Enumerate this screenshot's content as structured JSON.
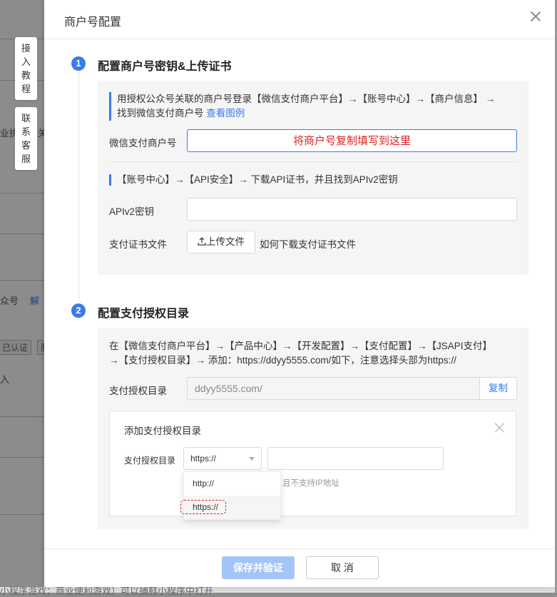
{
  "background": {
    "side_floats": [
      {
        "label": [
          "接",
          "入",
          "教",
          "程"
        ]
      },
      {
        "label": [
          "联",
          "系",
          "客",
          "服"
        ]
      }
    ],
    "fragments": {
      "text_1": "业执照",
      "text_2": "关",
      "text_3": "众号",
      "link_1": "解",
      "tag_1": "已认证",
      "tag_2": "服",
      "text_4": "入",
      "bottom": "小程序游戏；商业便利游戏）可以捕鞋小程序中打开"
    }
  },
  "modal": {
    "title": "商户号配置",
    "step1": {
      "number": "1",
      "title": "配置商户号密钥&上传证书",
      "hint1_text": "用授权公众号关联的商户号登录【微信支付商户平台】→【账号中心】→【商户信息】 →",
      "hint1_text2": "找到微信支付商户号",
      "hint1_link": "查看图例",
      "merchant_label": "微信支付商户号",
      "merchant_placeholder": "将商户号复制填写到这里",
      "hint2_text": "【账号中心】→【API安全】→ 下载API证书，并且找到APIv2密钥",
      "apikey_label": "APIv2密钥",
      "apikey_value": "",
      "cert_label": "支付证书文件",
      "upload_button": "上传文件",
      "cert_link": "如何下载支付证书文件"
    },
    "step2": {
      "number": "2",
      "title": "配置支付授权目录",
      "hint_line1": "在【微信支付商户平台】→【产品中心】→【开发配置】→【支付配置】→【JSAPI支付】",
      "hint_line2": "→【支付授权目录】→ 添加：https://ddyy5555.com/如下，注意选择头部为https://",
      "dir_label": "支付授权目录",
      "dir_value": "ddyy5555.com/",
      "copy_button": "复制",
      "sub": {
        "title": "添加支付授权目录",
        "label": "支付授权目录",
        "select_value": "https://",
        "options": [
          "http://",
          "https://"
        ],
        "tip": "且不支持IP地址"
      }
    },
    "footer": {
      "save_button": "保存并验证",
      "cancel_button": "取 消"
    }
  },
  "colors": {
    "accent": "#3a7bea",
    "hint_red": "#e02020",
    "disabled_primary": "#a3c4f7"
  }
}
